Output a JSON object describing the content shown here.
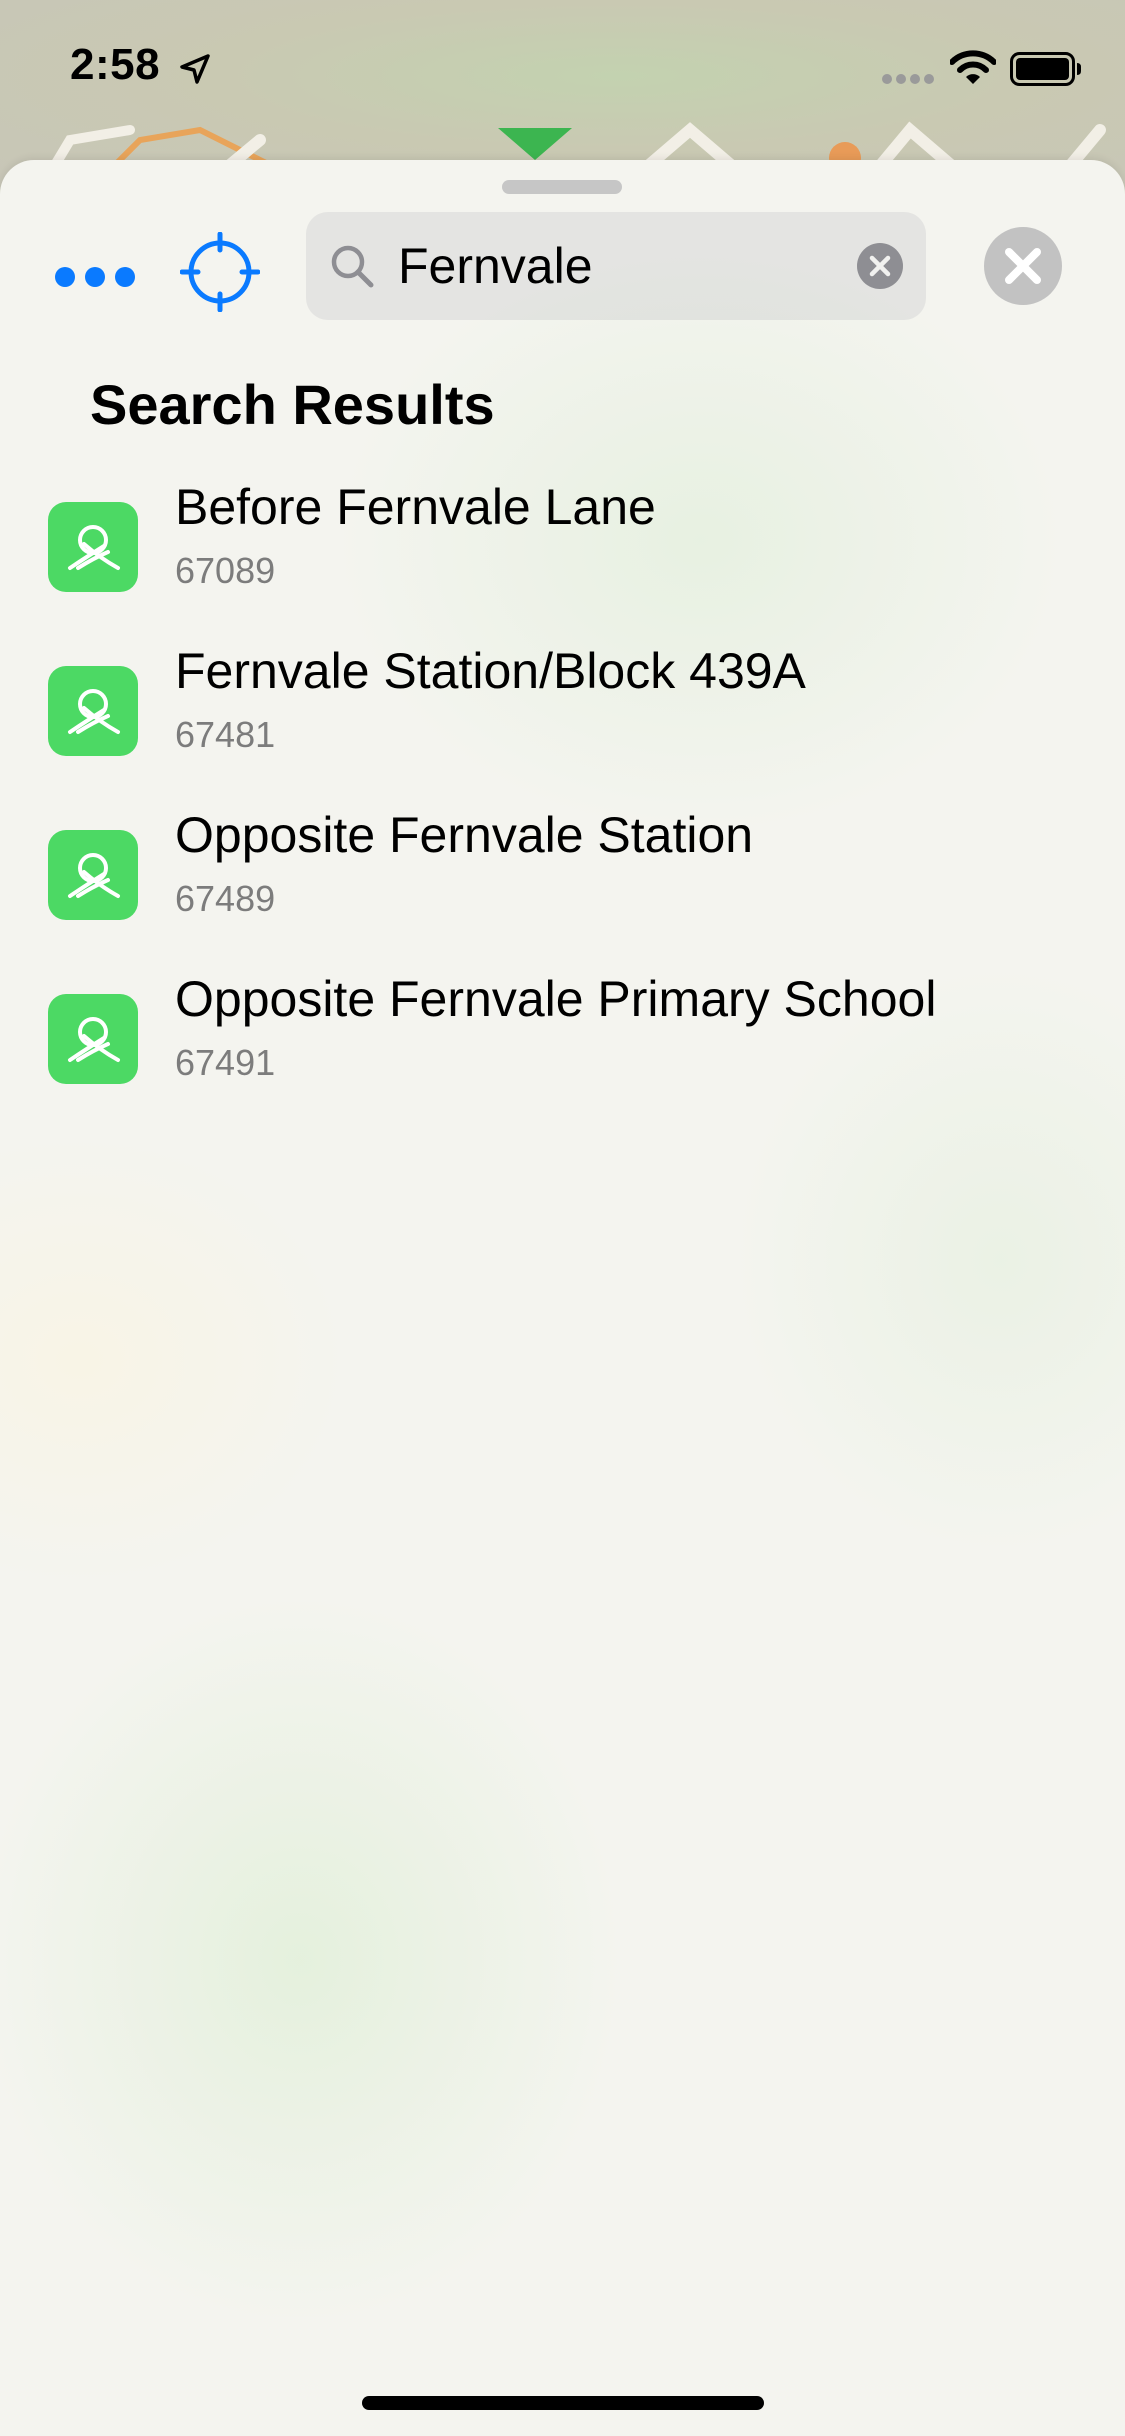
{
  "status_bar": {
    "time": "2:58"
  },
  "search": {
    "query": "Fernvale",
    "placeholder": ""
  },
  "results_section": {
    "title": "Search Results"
  },
  "results": [
    {
      "name": "Before Fernvale Lane",
      "code": "67089"
    },
    {
      "name": "Fernvale Station/Block 439A",
      "code": "67481"
    },
    {
      "name": "Opposite Fernvale Station",
      "code": "67489"
    },
    {
      "name": "Opposite Fernvale Primary School",
      "code": "67491"
    }
  ],
  "icons": {
    "more": "ellipsis-icon",
    "locate": "crosshair-icon",
    "search": "magnifier-icon",
    "clear": "clear-circle-icon",
    "close": "close-circle-icon",
    "bus_stop": "bus-stop-icon"
  },
  "colors": {
    "accent": "#0a7aff",
    "badge_green": "#4cd964",
    "secondary_text": "#7c7c7c"
  }
}
